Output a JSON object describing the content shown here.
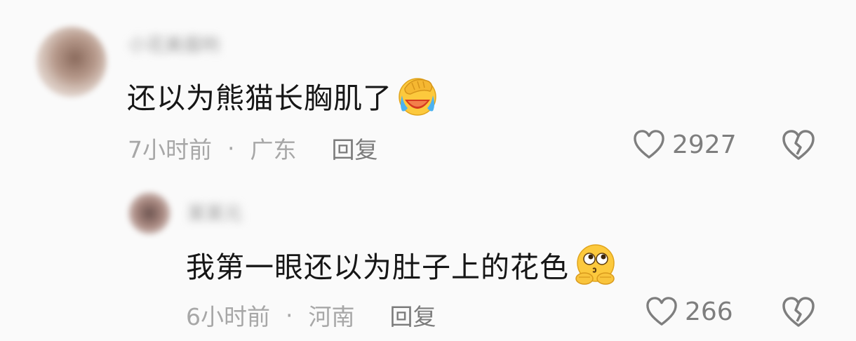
{
  "comments": [
    {
      "username": "小花美眉哟",
      "content": "还以为熊猫长胸肌了",
      "emoji": "laughing-crying-facepalm-emoji",
      "time": "7小时前",
      "separator": "·",
      "location": "广东",
      "reply_label": "回复",
      "like_count": "2927"
    },
    {
      "username": "某某元",
      "content": "我第一眼还以为肚子上的花色",
      "emoji": "thinking-hands-emoji",
      "time": "6小时前",
      "separator": "·",
      "location": "河南",
      "reply_label": "回复",
      "like_count": "266"
    }
  ],
  "colors": {
    "background": "#fafafa",
    "text_primary": "#161616",
    "text_meta": "#a7a7a7",
    "icon_gray": "#7e7e7e"
  }
}
